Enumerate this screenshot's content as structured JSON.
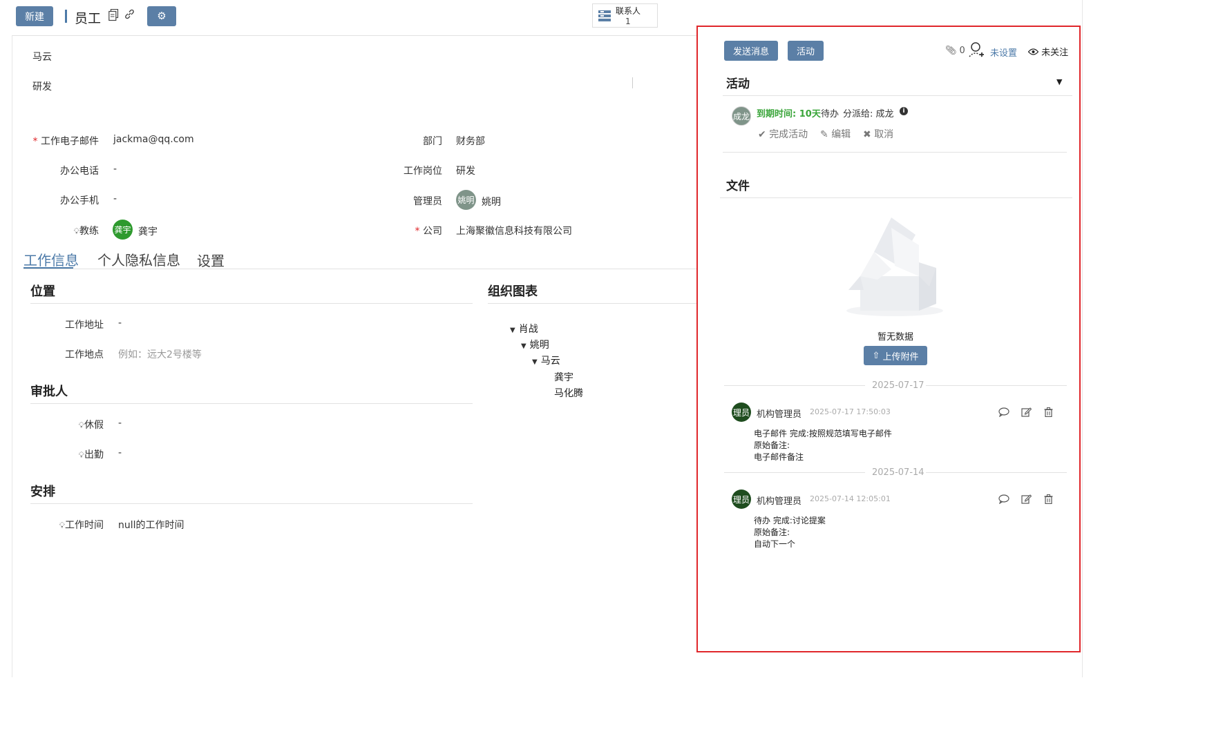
{
  "toolbar": {
    "new_button": "新建",
    "title": "员工",
    "contacts_label": "联系人",
    "contacts_count": "1"
  },
  "header_fields": {
    "name": "马云",
    "job_title": "研发"
  },
  "form": {
    "work_email_label": "工作电子邮件",
    "work_email_value": "jackma@qq.com",
    "office_phone_label": "办公电话",
    "office_phone_value": "-",
    "mobile_label": "办公手机",
    "mobile_value": "-",
    "coach_label": "教练",
    "coach_avatar": "龚宇",
    "coach_value": "龚宇",
    "department_label": "部门",
    "department_value": "财务部",
    "position_label": "工作岗位",
    "position_value": "研发",
    "manager_label": "管理员",
    "manager_avatar": "姚明",
    "manager_value": "姚明",
    "company_label": "公司",
    "company_value": "上海聚徽信息科技有限公司"
  },
  "tabs": [
    {
      "label": "工作信息"
    },
    {
      "label": "个人隐私信息"
    },
    {
      "label": "设置"
    }
  ],
  "location": {
    "title": "位置",
    "address_label": "工作地址",
    "address_value": "-",
    "place_label": "工作地点",
    "place_placeholder": "例如：远大2号楼等"
  },
  "approver": {
    "title": "审批人",
    "leave_label": "休假",
    "leave_value": "-",
    "attendance_label": "出勤",
    "attendance_value": "-"
  },
  "schedule": {
    "title": "安排",
    "hours_label": "工作时间",
    "hours_value": "null的工作时间"
  },
  "org_chart": {
    "title": "组织图表",
    "nodes": [
      "肖战",
      "姚明",
      "马云",
      "龚宇",
      "马化腾"
    ]
  },
  "chatter": {
    "send_message": "发送消息",
    "activity_button": "活动",
    "attachment_count": "0",
    "unset_label": "未设置",
    "follow_label": "未关注",
    "activities_title": "活动",
    "activity": {
      "avatar": "成龙",
      "due_label": "到期时间: 10天",
      "type": "待办",
      "assigned": "分派给: 成龙",
      "done": "完成活动",
      "edit": "编辑",
      "cancel": "取消"
    },
    "files_title": "文件",
    "empty_text": "暂无数据",
    "upload_button": "上传附件",
    "messages": [
      {
        "date_divider": "2025-07-17",
        "avatar": "理员",
        "author": "机构管理员",
        "timestamp": "2025-07-17 17:50:03",
        "line1": "电子邮件 完成:按照规范填写电子邮件",
        "line2": "原始备注:",
        "line3": "电子邮件备注"
      },
      {
        "date_divider": "2025-07-14",
        "avatar": "理员",
        "author": "机构管理员",
        "timestamp": "2025-07-14 12:05:01",
        "line1": "待办 完成:讨论提案",
        "line2": "原始备注:",
        "line3": "自动下一个"
      }
    ]
  },
  "colors": {
    "primary": "#5b7fa6",
    "highlight_border": "#e0262a",
    "due_green": "#3aa53a",
    "avatar_dark_green": "#1f4d1f",
    "avatar_green": "#2e9a2e",
    "avatar_gray": "#7f9489",
    "tab_active": "#4c7aa8"
  }
}
